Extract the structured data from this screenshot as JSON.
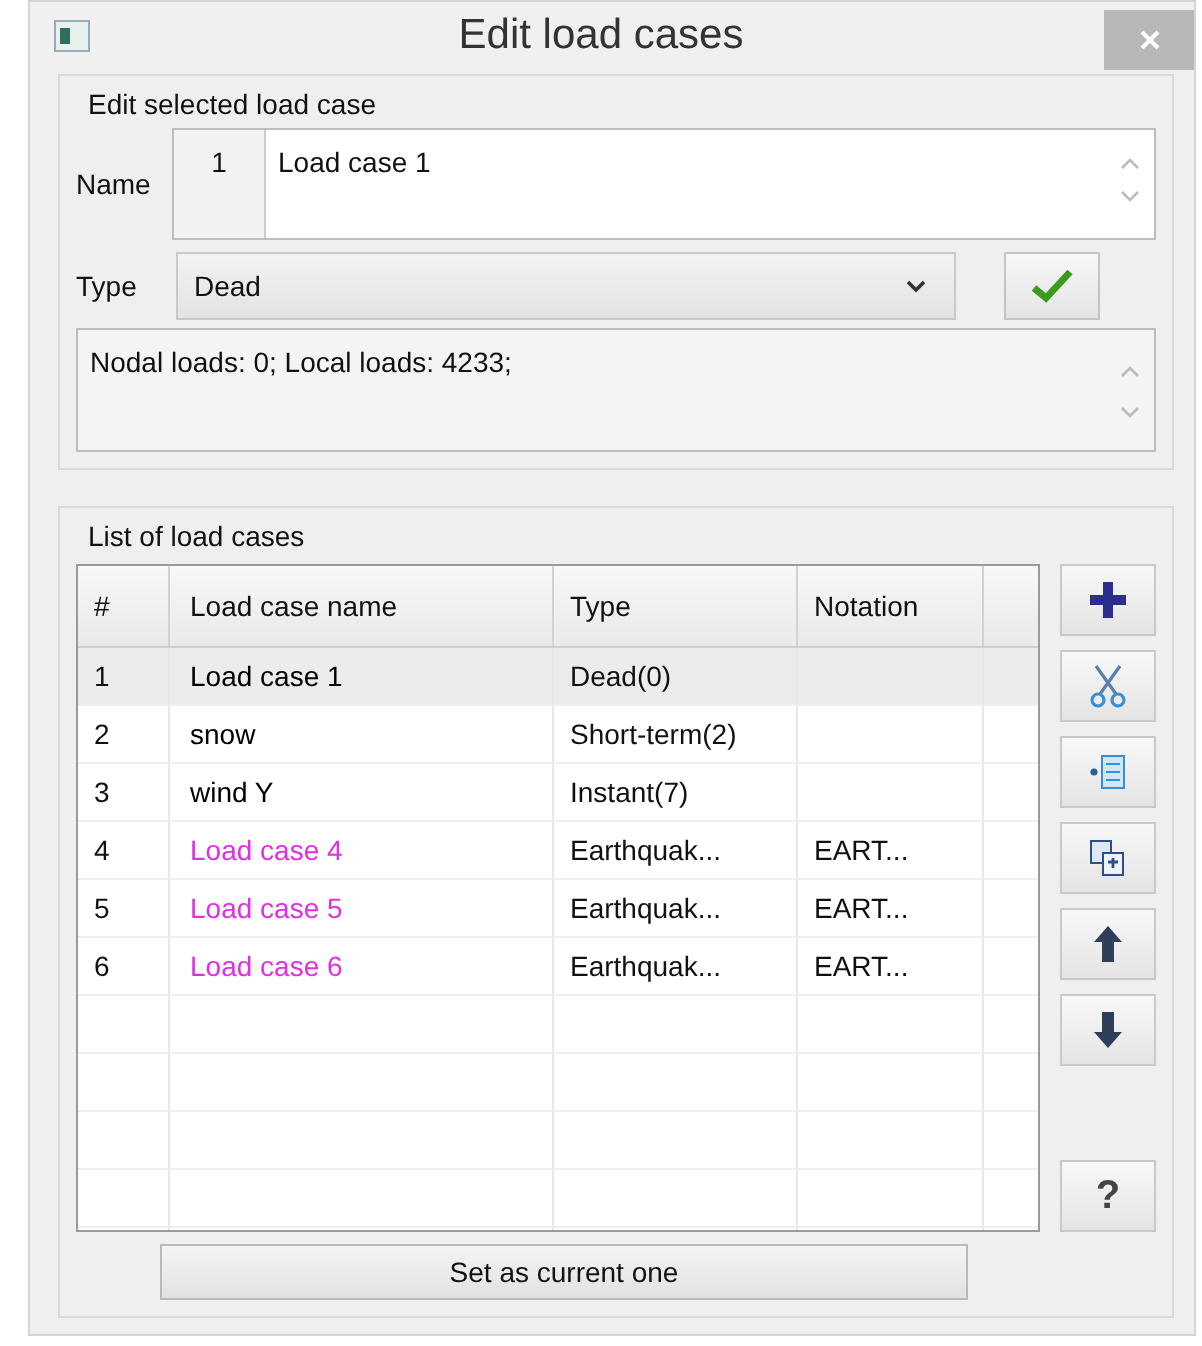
{
  "window": {
    "title": "Edit load cases"
  },
  "edit_group": {
    "title": "Edit selected load case",
    "name_label": "Name",
    "number": "1",
    "name_value": "Load case 1",
    "type_label": "Type",
    "type_value": "Dead",
    "info": "Nodal loads:  0;  Local loads:  4233;"
  },
  "list_group": {
    "title": "List of load cases"
  },
  "table": {
    "columns": [
      "#",
      "Load case name",
      "Type",
      "Notation"
    ],
    "rows": [
      {
        "num": "1",
        "name": "Load case 1",
        "type": "Dead(0)",
        "selected": true,
        "color": "#000000"
      },
      {
        "num": "2",
        "name": "snow",
        "type": "Short-term(2)",
        "selected": false,
        "color": "#000000"
      },
      {
        "num": "3",
        "name": "wind Y",
        "type": "Instant(7)",
        "selected": false,
        "color": "#000000"
      },
      {
        "num": "4",
        "name": "Load case 4",
        "type": "Earthquak...",
        "notation": "EART...",
        "selected": false,
        "color": "#e030e0"
      },
      {
        "num": "5",
        "name": "Load case 5",
        "type": "Earthquak...",
        "notation": "EART...",
        "selected": false,
        "color": "#e030e0"
      },
      {
        "num": "6",
        "name": "Load case 6",
        "type": "Earthquak...",
        "notation": "EART...",
        "selected": false,
        "color": "#e030e0"
      }
    ]
  },
  "side_buttons": [
    {
      "kind": "add"
    },
    {
      "kind": "cut"
    },
    {
      "kind": "insert"
    },
    {
      "kind": "copy"
    },
    {
      "kind": "up"
    },
    {
      "kind": "down"
    },
    {
      "kind": "help",
      "label": "?"
    }
  ],
  "set_button": "Set as current one"
}
